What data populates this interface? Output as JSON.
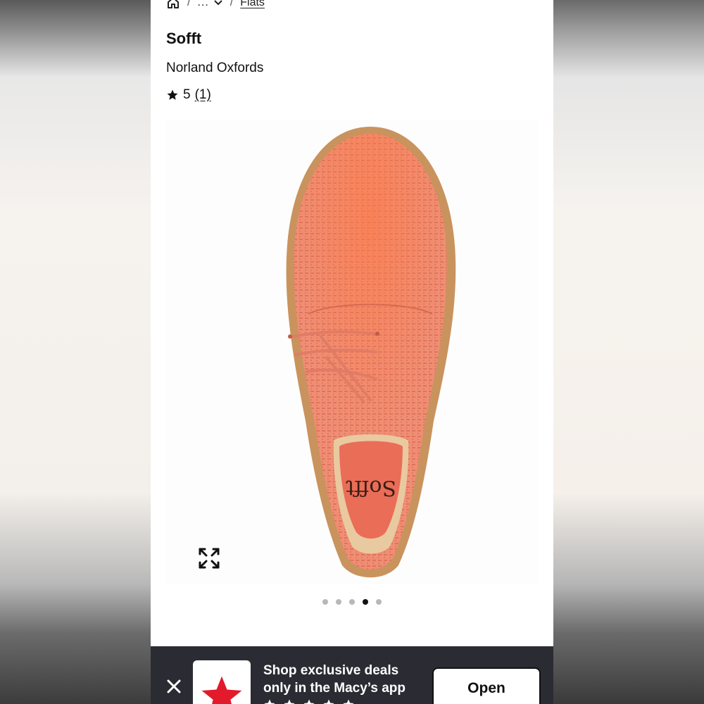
{
  "breadcrumb": {
    "ellipsis": "...",
    "current": "Flats",
    "icons": [
      "home-icon",
      "chevron-down-icon"
    ]
  },
  "product": {
    "brand": "Sofft",
    "name": "Norland Oxfords",
    "rating": "5",
    "review_count": "(1)",
    "rating_icon": "star-icon",
    "color": "#ee8a70"
  },
  "gallery": {
    "total_images": 5,
    "active_index": 4,
    "insole_logo": "Sofft",
    "zoom_icon": "expand-icon"
  },
  "app_banner": {
    "text": "Shop exclusive deals only in the Macy’s app",
    "open_label": "Open",
    "close_icon": "close-icon",
    "logo_icon": "macys-star-icon",
    "star_rating": 5,
    "brand_color": "#e21a2c"
  }
}
